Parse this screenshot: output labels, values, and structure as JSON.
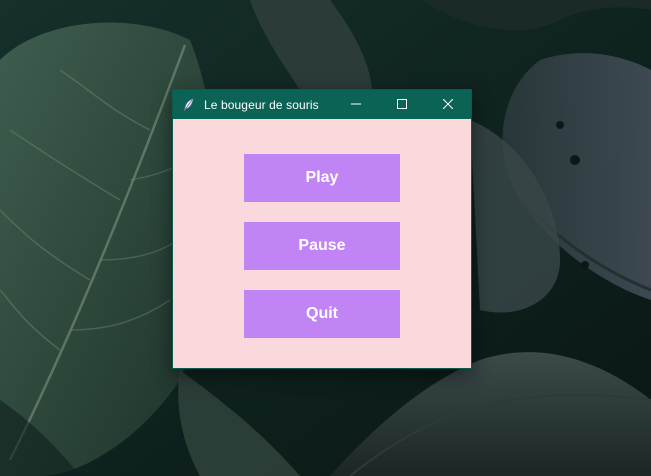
{
  "window": {
    "title": "Le bougeur de souris",
    "icon": "feather-icon",
    "controls": [
      "minimize-icon",
      "maximize-icon",
      "close-icon"
    ]
  },
  "buttons": {
    "play": "Play",
    "pause": "Pause",
    "quit": "Quit"
  },
  "colors": {
    "titlebar": "#0b6355",
    "window_background": "#fad9dc",
    "button_background": "#c084f5",
    "button_text": "#ffffff"
  }
}
